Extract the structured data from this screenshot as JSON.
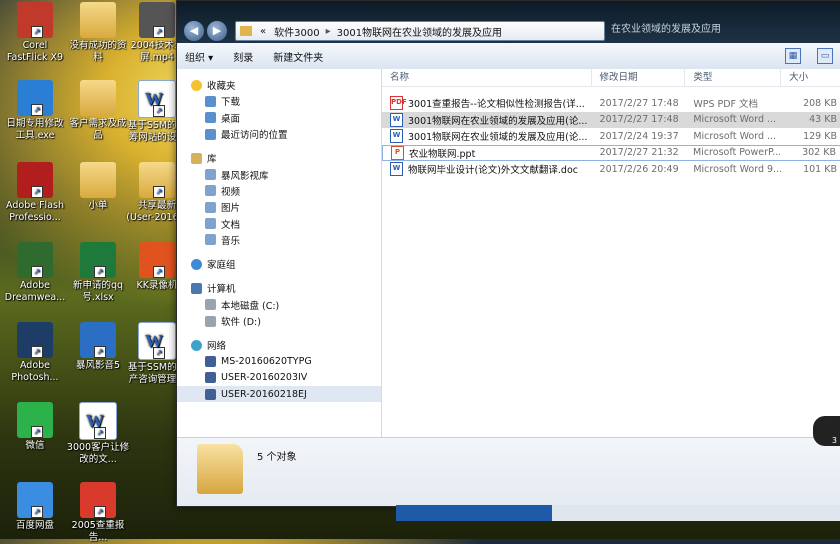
{
  "desktop": {
    "icons": [
      {
        "label": "Corel FastFlick X9",
        "color": "#c0392b"
      },
      {
        "label": "没有成功的资料",
        "color": "#e1b44c"
      },
      {
        "label": "2004技术录屏.mp4",
        "color": "#555"
      },
      {
        "label": "日期专用修改工具.exe",
        "color": "#2a7fd4"
      },
      {
        "label": "客户需求及成品",
        "color": "#e1b44c"
      },
      {
        "label": "基于SSM的众筹网站的设...",
        "color": "#2b5fb3"
      },
      {
        "label": "Adobe Flash Professio...",
        "color": "#b21d1d"
      },
      {
        "label": "小单",
        "color": "#e1b44c"
      },
      {
        "label": "共享最新(User-2016...",
        "color": "#e1b44c"
      },
      {
        "label": "Adobe Dreamwea...",
        "color": "#2f6b2f"
      },
      {
        "label": "新申请的qq号.xlsx",
        "color": "#1e7a3a"
      },
      {
        "label": "KK录像机",
        "color": "#e0531f"
      },
      {
        "label": "Adobe Photosh...",
        "color": "#1d3c66"
      },
      {
        "label": "暴风影音5",
        "color": "#2a6fc4"
      },
      {
        "label": "基于SSM的房产咨询管理...",
        "color": "#2b5fb3"
      },
      {
        "label": "微信",
        "color": "#2cb24a"
      },
      {
        "label": "3000客户让修改的文...",
        "color": "#2b5fb3"
      },
      {
        "label": "百度网盘",
        "color": "#3a8de0"
      },
      {
        "label": "2005查重报告...",
        "color": "#d93a2b"
      }
    ]
  },
  "window": {
    "breadcrumb": [
      "«",
      "软件3000",
      "3001物联网在农业领域的发展及应用"
    ],
    "search_text": "在农业领域的发展及应用",
    "toolbar": {
      "organize": "组织 ▾",
      "burn": "刻录",
      "new_folder": "新建文件夹"
    },
    "nav": {
      "favorites_title": "收藏夹",
      "favorites": [
        "下载",
        "桌面",
        "最近访问的位置"
      ],
      "libraries_title": "库",
      "libraries": [
        "暴风影视库",
        "视频",
        "图片",
        "文档",
        "音乐"
      ],
      "homegroup": "家庭组",
      "computer_title": "计算机",
      "drives": [
        "本地磁盘 (C:)",
        "软件 (D:)"
      ],
      "network_title": "网络",
      "network": [
        "MS-20160620TYPG",
        "USER-20160203IV",
        "USER-20160218EJ"
      ]
    },
    "columns": [
      "名称",
      "修改日期",
      "类型",
      "大小"
    ],
    "files": [
      {
        "name": "3001查重报告--论文相似性检测报告(详...",
        "date": "2017/2/27 17:48",
        "type": "WPS PDF 文档",
        "size": "208 KB",
        "icon": "pdf-icon"
      },
      {
        "name": "3001物联网在农业领域的发展及应用(论...",
        "date": "2017/2/27 17:48",
        "type": "Microsoft Word ...",
        "size": "43 KB",
        "icon": "word-icon"
      },
      {
        "name": "3001物联网在农业领域的发展及应用(论...",
        "date": "2017/2/24 19:37",
        "type": "Microsoft Word ...",
        "size": "129 KB",
        "icon": "word-icon"
      },
      {
        "name": "农业物联网.ppt",
        "date": "2017/2/27 21:32",
        "type": "Microsoft PowerP...",
        "size": "302 KB",
        "icon": "ppt-icon"
      },
      {
        "name": "物联网毕业设计(论文)外文文献翻译.doc",
        "date": "2017/2/26 20:49",
        "type": "Microsoft Word 9...",
        "size": "101 KB",
        "icon": "word-icon"
      }
    ],
    "status": "5 个对象",
    "side_badge": "3"
  }
}
